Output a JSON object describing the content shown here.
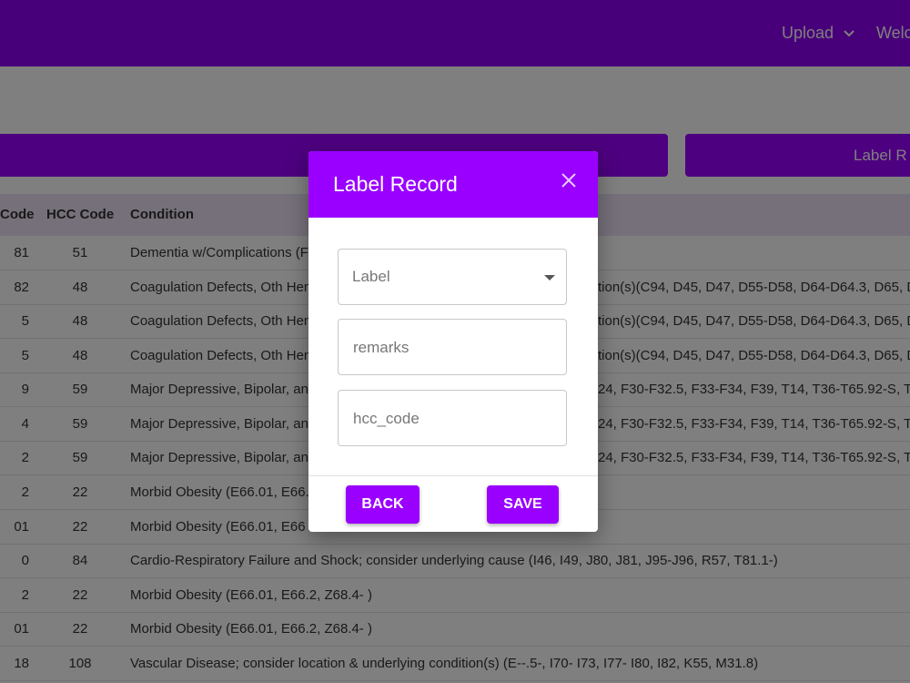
{
  "header": {
    "upload_label": "Upload",
    "welcome_label": "Welc"
  },
  "action_bar": {
    "right_button_label": "Label R"
  },
  "table": {
    "columns": [
      "Code",
      "HCC Code",
      "Condition"
    ],
    "rows": [
      {
        "code": "81",
        "hcc": "51",
        "condition": "Dementia w/Complications (F"
      },
      {
        "code": "82",
        "hcc": "48",
        "condition": "Coagulation Defects, Oth Hem"
      },
      {
        "code": "5",
        "hcc": "48",
        "condition": "Coagulation Defects, Oth Hem"
      },
      {
        "code": "5",
        "hcc": "48",
        "condition": "Coagulation Defects, Oth Hem"
      },
      {
        "code": "9",
        "hcc": "59",
        "condition": "Major Depressive, Bipolar, and"
      },
      {
        "code": "4",
        "hcc": "59",
        "condition": "Major Depressive, Bipolar, and"
      },
      {
        "code": "2",
        "hcc": "59",
        "condition": "Major Depressive, Bipolar, and"
      },
      {
        "code": "2",
        "hcc": "22",
        "condition": "Morbid Obesity (E66.01, E66."
      },
      {
        "code": "01",
        "hcc": "22",
        "condition": "Morbid Obesity (E66.01, E66"
      },
      {
        "code": "0",
        "hcc": "84",
        "condition": "Cardio-Respiratory Failure and Shock; consider underlying cause (I46, I49, J80, J81, J95-J96, R57, T81.1-)"
      },
      {
        "code": "2",
        "hcc": "22",
        "condition": "Morbid Obesity (E66.01, E66.2, Z68.4- )"
      },
      {
        "code": "01",
        "hcc": "22",
        "condition": "Morbid Obesity (E66.01, E66.2, Z68.4- )"
      },
      {
        "code": "18",
        "hcc": "108",
        "condition": "Vascular Disease; consider location & underlying condition(s) (E--.5-, I70- I73, I77- I80, I82, K55, M31.8)"
      }
    ],
    "tails": {
      "dementia": "",
      "coag": "tion(s)(C94, D45, D47, D55-D58, D64-D64.3, D65, D",
      "depr": "24, F30-F32.5, F33-F34, F39, T14, T36-T65.92-S, T7"
    }
  },
  "modal": {
    "title": "Label Record",
    "label_select_placeholder": "Label",
    "remarks_placeholder": "remarks",
    "hcc_code_placeholder": "hcc_code",
    "back_label": "BACK",
    "save_label": "SAVE"
  }
}
